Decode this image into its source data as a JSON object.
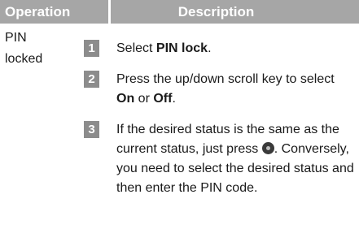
{
  "table": {
    "headers": {
      "operation": "Operation",
      "description": "Description"
    },
    "row": {
      "operation_line1": "PIN",
      "operation_line2": "locked",
      "steps": [
        {
          "number": "1",
          "text_before": "Select ",
          "bold": "PIN lock",
          "text_after": "."
        },
        {
          "number": "2",
          "text_before": "Press the up/down scroll key to select ",
          "bold1": "On",
          "middle": " or ",
          "bold2": "Off",
          "text_after": "."
        },
        {
          "number": "3",
          "text_before": "If the desired status is the same as the current status, just press ",
          "icon": "ok-key-icon",
          "text_after": ". Conversely, you need to select the desired status and then enter the PIN code."
        }
      ]
    }
  },
  "colors": {
    "header_bg": "#a6a6a6",
    "step_badge_bg": "#8c8c8c",
    "text": "#1a1a1a"
  }
}
